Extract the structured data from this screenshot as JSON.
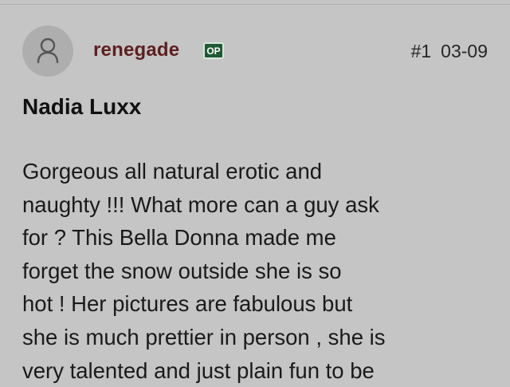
{
  "post": {
    "author": "renegade",
    "badge": "OP",
    "number": "#1",
    "date": "03-09",
    "avatar_icon": "person-icon",
    "title": "Nadia Luxx",
    "body_lines": [
      "Gorgeous all natural erotic and",
      "naughty !!! What more can a guy ask",
      "for ? This Bella Donna made me",
      "forget the snow outside she is so",
      "hot ! Her pictures are fabulous but",
      "she is much prettier in person , she is",
      "very talented and just plain fun to be"
    ]
  },
  "colors": {
    "background": "#c5c5c5",
    "username": "#5e1f1f",
    "badge_bg": "#1f5a34"
  }
}
